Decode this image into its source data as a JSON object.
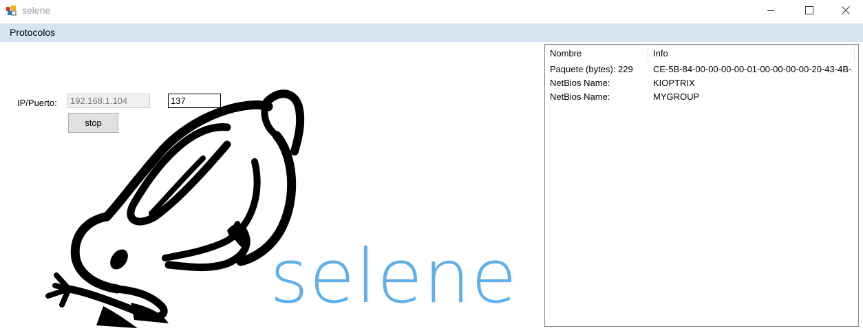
{
  "window": {
    "title": "selene",
    "icon": "app-icon",
    "controls": [
      "minimize-icon",
      "maximize-icon",
      "close-icon"
    ]
  },
  "menu": {
    "items": [
      {
        "label": "Protocolos"
      }
    ]
  },
  "form": {
    "ip_label": "IP/Puerto:",
    "ip_value": "192.168.1.104",
    "port_value": "137",
    "stop_label": "stop"
  },
  "logo": {
    "text": "selene",
    "color": "#5fb0ea",
    "icon": "rabbit-logo"
  },
  "listview": {
    "columns": [
      "Nombre",
      "Info"
    ],
    "rows": [
      {
        "nombre": "Paquete (bytes): 229",
        "info": "CE-5B-84-00-00-00-00-01-00-00-00-00-20-43-4B-..."
      },
      {
        "nombre": "NetBios Name:",
        "info": "KIOPTRIX"
      },
      {
        "nombre": "NetBios Name:",
        "info": "MYGROUP"
      }
    ]
  },
  "colors": {
    "menubar": "#d6e4f1",
    "accent": "#5fb0ea"
  }
}
